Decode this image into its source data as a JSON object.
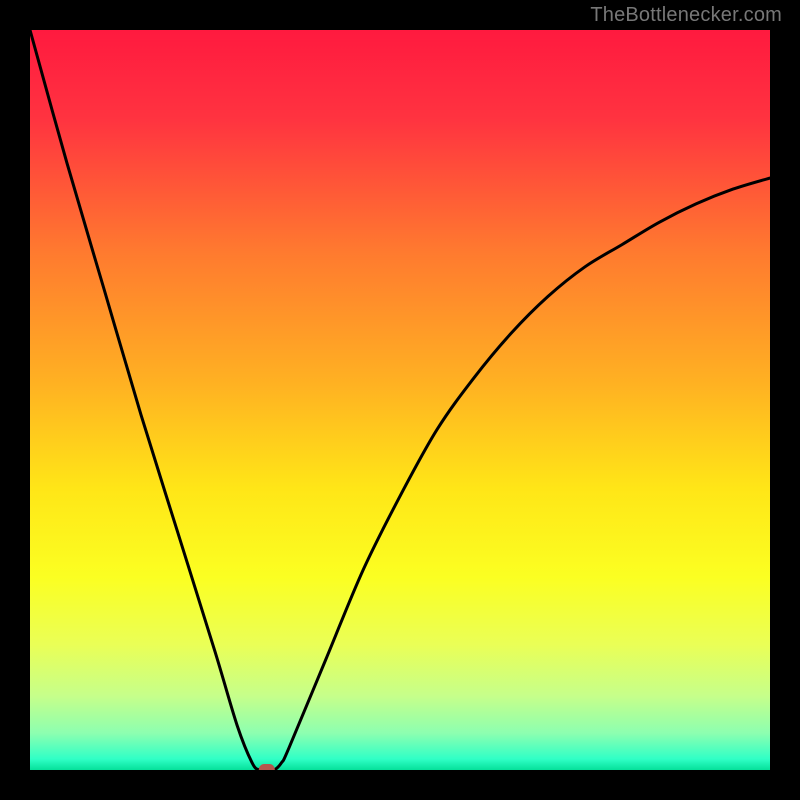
{
  "attribution": "TheBottlenecker.com",
  "chart_data": {
    "type": "line",
    "title": "",
    "xlabel": "",
    "ylabel": "",
    "xlim": [
      0,
      100
    ],
    "ylim": [
      0,
      100
    ],
    "series": [
      {
        "name": "bottleneck-curve",
        "x": [
          0,
          5,
          10,
          15,
          20,
          25,
          28,
          30,
          31,
          32,
          33,
          34,
          35,
          40,
          45,
          50,
          55,
          60,
          65,
          70,
          75,
          80,
          85,
          90,
          95,
          100
        ],
        "y": [
          100,
          82,
          65,
          48,
          32,
          16,
          6,
          1,
          0,
          0,
          0,
          1,
          3,
          15,
          27,
          37,
          46,
          53,
          59,
          64,
          68,
          71,
          74,
          76.5,
          78.5,
          80
        ]
      }
    ],
    "marker": {
      "x": 32,
      "y": 0,
      "name": "optimal-point"
    },
    "gradient_stops": [
      {
        "offset": 0.0,
        "color": "#ff1a3f"
      },
      {
        "offset": 0.12,
        "color": "#ff3340"
      },
      {
        "offset": 0.3,
        "color": "#ff7a2f"
      },
      {
        "offset": 0.48,
        "color": "#ffb222"
      },
      {
        "offset": 0.62,
        "color": "#ffe617"
      },
      {
        "offset": 0.74,
        "color": "#fbff22"
      },
      {
        "offset": 0.83,
        "color": "#eaff56"
      },
      {
        "offset": 0.9,
        "color": "#c6ff8a"
      },
      {
        "offset": 0.95,
        "color": "#8dffb0"
      },
      {
        "offset": 0.985,
        "color": "#30ffc6"
      },
      {
        "offset": 1.0,
        "color": "#05e09a"
      }
    ],
    "marker_color": "#b4554d",
    "curve_color": "#000000"
  }
}
